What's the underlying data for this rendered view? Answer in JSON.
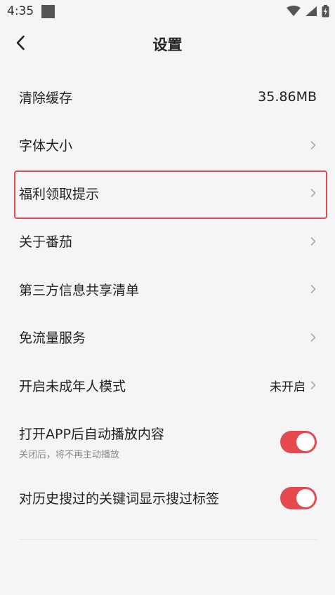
{
  "status_bar": {
    "time": "4:35"
  },
  "header": {
    "title": "设置"
  },
  "settings": {
    "clear_cache": {
      "label": "清除缓存",
      "value": "35.86MB"
    },
    "font_size": {
      "label": "字体大小"
    },
    "welfare_reminder": {
      "label": "福利领取提示"
    },
    "about": {
      "label": "关于番茄"
    },
    "third_party_list": {
      "label": "第三方信息共享清单"
    },
    "free_data_service": {
      "label": "免流量服务"
    },
    "minor_mode": {
      "label": "开启未成年人模式",
      "value": "未开启"
    },
    "autoplay": {
      "label": "打开APP后自动播放内容",
      "sublabel": "关闭后，将不再主动播放",
      "enabled": true
    },
    "search_history_tags": {
      "label": "对历史搜过的关键词显示搜过标签",
      "enabled": true
    }
  },
  "colors": {
    "accent": "#e5484d",
    "background": "#f5f5f7"
  }
}
